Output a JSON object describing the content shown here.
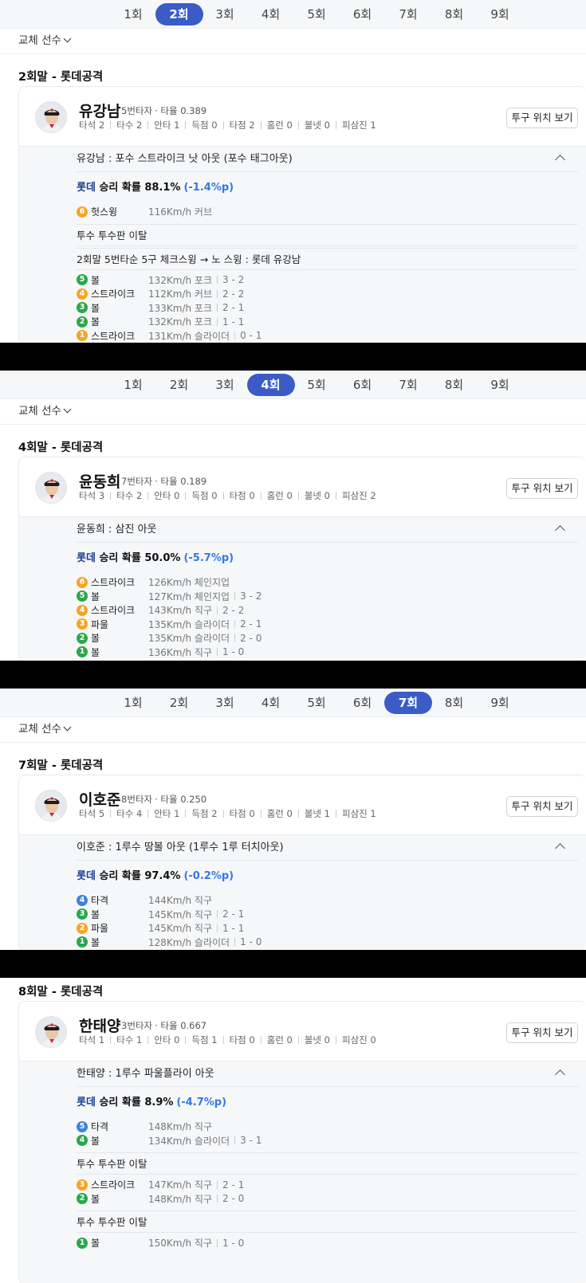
{
  "sections": [
    {
      "tabs": [
        "1회",
        "2회",
        "3회",
        "4회",
        "5회",
        "6회",
        "7회",
        "8회",
        "9회"
      ],
      "active_tab": 1,
      "substitute_label": "교체 선수",
      "inning_title": "2회말 - 롯데공격",
      "player": {
        "name": "유강남",
        "order": "5번타자",
        "avg": "· 타율 0.389",
        "stats": [
          "타석 2",
          "타수 2",
          "안타 1",
          "득점 0",
          "타점 2",
          "홈런 0",
          "볼넷 0",
          "피삼진 1"
        ],
        "button": "투구 위치 보기"
      },
      "result": "유강남 : 포수 스트라이크 낫 아웃 (포수 태그아웃)",
      "prob": {
        "team": "롯데",
        "label": " 승리 확률 ",
        "value": "88.1%",
        "delta": "(-1.4%p)"
      },
      "groups": [
        {
          "type": "pitches",
          "items": [
            {
              "n": "6",
              "color": "orange",
              "result": "헛스윙",
              "speed": "116Km/h 커브",
              "count": ""
            }
          ]
        },
        {
          "type": "note",
          "text": "투수 투수판 이탈"
        },
        {
          "type": "note",
          "text": "2회말 5번타순 5구 체크스윙 → 노 스윙 : 롯데 유강남"
        },
        {
          "type": "pitches",
          "items": [
            {
              "n": "5",
              "color": "green",
              "result": "볼",
              "speed": "132Km/h 포크",
              "count": "3 - 2"
            },
            {
              "n": "4",
              "color": "orange",
              "result": "스트라이크",
              "speed": "112Km/h 커브",
              "count": "2 - 2"
            },
            {
              "n": "3",
              "color": "green",
              "result": "볼",
              "speed": "133Km/h 포크",
              "count": "2 - 1"
            },
            {
              "n": "2",
              "color": "green",
              "result": "볼",
              "speed": "132Km/h 포크",
              "count": "1 - 1"
            },
            {
              "n": "1",
              "color": "orange",
              "result": "스트라이크",
              "speed": "131Km/h 슬라이더",
              "count": "0 - 1"
            }
          ]
        }
      ]
    },
    {
      "tabs": [
        "1회",
        "2회",
        "3회",
        "4회",
        "5회",
        "6회",
        "7회",
        "8회",
        "9회"
      ],
      "active_tab": 3,
      "substitute_label": "교체 선수",
      "inning_title": "4회말 - 롯데공격",
      "player": {
        "name": "윤동희",
        "order": "7번타자",
        "avg": "· 타율 0.189",
        "stats": [
          "타석 3",
          "타수 2",
          "안타 0",
          "득점 0",
          "타점 0",
          "홈런 0",
          "볼넷 0",
          "피삼진 2"
        ],
        "button": "투구 위치 보기"
      },
      "result": "윤동희 : 삼진 아웃",
      "prob": {
        "team": "롯데",
        "label": " 승리 확률 ",
        "value": "50.0%",
        "delta": "(-5.7%p)"
      },
      "groups": [
        {
          "type": "pitches",
          "items": [
            {
              "n": "6",
              "color": "orange",
              "result": "스트라이크",
              "speed": "126Km/h 체인지업",
              "count": ""
            },
            {
              "n": "5",
              "color": "green",
              "result": "볼",
              "speed": "127Km/h 체인지업",
              "count": "3 - 2"
            },
            {
              "n": "4",
              "color": "orange",
              "result": "스트라이크",
              "speed": "143Km/h 직구",
              "count": "2 - 2"
            },
            {
              "n": "3",
              "color": "orange",
              "result": "파울",
              "speed": "135Km/h 슬라이더",
              "count": "2 - 1"
            },
            {
              "n": "2",
              "color": "green",
              "result": "볼",
              "speed": "135Km/h 슬라이더",
              "count": "2 - 0"
            },
            {
              "n": "1",
              "color": "green",
              "result": "볼",
              "speed": "136Km/h 직구",
              "count": "1 - 0"
            }
          ]
        }
      ]
    },
    {
      "tabs": [
        "1회",
        "2회",
        "3회",
        "4회",
        "5회",
        "6회",
        "7회",
        "8회",
        "9회"
      ],
      "active_tab": 6,
      "substitute_label": "교체 선수",
      "inning_title": "7회말 - 롯데공격",
      "player": {
        "name": "이호준",
        "order": "8번타자",
        "avg": "· 타율 0.250",
        "stats": [
          "타석 5",
          "타수 4",
          "안타 1",
          "득점 2",
          "타점 0",
          "홈런 0",
          "볼넷 1",
          "피삼진 1"
        ],
        "button": "투구 위치 보기"
      },
      "result": "이호준 : 1루수 땅볼 아웃 (1루수 1루 터치아웃)",
      "prob": {
        "team": "롯데",
        "label": " 승리 확률 ",
        "value": "97.4%",
        "delta": "(-0.2%p)"
      },
      "groups": [
        {
          "type": "pitches",
          "items": [
            {
              "n": "4",
              "color": "blue",
              "result": "타격",
              "speed": "144Km/h 직구",
              "count": ""
            },
            {
              "n": "3",
              "color": "green",
              "result": "볼",
              "speed": "145Km/h 직구",
              "count": "2 - 1"
            },
            {
              "n": "2",
              "color": "orange",
              "result": "파울",
              "speed": "145Km/h 직구",
              "count": "1 - 1"
            },
            {
              "n": "1",
              "color": "green",
              "result": "볼",
              "speed": "128Km/h 슬라이더",
              "count": "1 - 0"
            }
          ]
        }
      ]
    },
    {
      "tabs": [],
      "active_tab": -1,
      "substitute_label": "",
      "inning_title": "8회말 - 롯데공격",
      "player": {
        "name": "한태양",
        "order": "3번타자",
        "avg": "· 타율 0.667",
        "stats": [
          "타석 1",
          "타수 1",
          "안타 0",
          "득점 1",
          "타점 0",
          "홈런 0",
          "볼넷 0",
          "피삼진 0"
        ],
        "button": "투구 위치 보기"
      },
      "result": "한태양 : 1루수 파울플라이 아웃",
      "prob": {
        "team": "롯데",
        "label": " 승리 확률 ",
        "value": "8.9%",
        "delta": "(-4.7%p)"
      },
      "groups": [
        {
          "type": "pitches",
          "items": [
            {
              "n": "5",
              "color": "blue",
              "result": "타격",
              "speed": "148Km/h 직구",
              "count": ""
            },
            {
              "n": "4",
              "color": "green",
              "result": "볼",
              "speed": "134Km/h 슬라이더",
              "count": "3 - 1"
            }
          ]
        },
        {
          "type": "note",
          "text": "투수 투수판 이탈"
        },
        {
          "type": "pitches",
          "items": [
            {
              "n": "3",
              "color": "orange",
              "result": "스트라이크",
              "speed": "147Km/h 직구",
              "count": "2 - 1"
            },
            {
              "n": "2",
              "color": "green",
              "result": "볼",
              "speed": "148Km/h 직구",
              "count": "2 - 0"
            }
          ]
        },
        {
          "type": "note",
          "text": "투수 투수판 이탈"
        },
        {
          "type": "pitches",
          "items": [
            {
              "n": "1",
              "color": "green",
              "result": "볼",
              "speed": "150Km/h 직구",
              "count": "1 - 0"
            }
          ]
        }
      ]
    }
  ],
  "colors": {
    "active_tab": "#3b5cc6",
    "team": "#1b3f8b",
    "delta": "#3478e5",
    "strike": "#f5a524",
    "ball": "#2aa84a",
    "hit": "#3c82df"
  },
  "icons": {
    "substitute": "chevron-down-icon",
    "collapse": "chevron-up-icon",
    "avatar": "player-avatar-icon"
  }
}
